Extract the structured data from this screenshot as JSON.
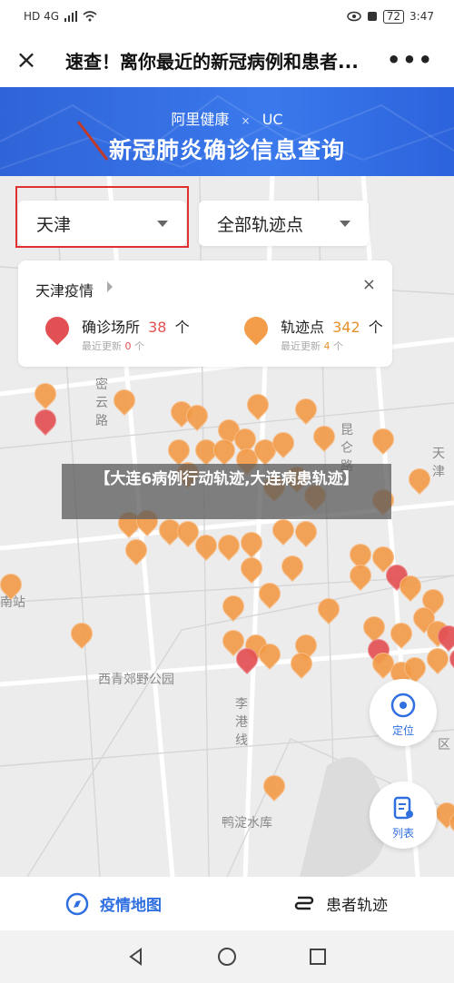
{
  "status_bar": {
    "left_text": "HD 4G",
    "battery": "72",
    "time": "3:47"
  },
  "app_bar": {
    "title": "速查！离你最近的新冠病例和患者..."
  },
  "banner": {
    "brand_left": "阿里健康",
    "separator": "×",
    "brand_right": "UC",
    "heading": "新冠肺炎确诊信息查询"
  },
  "filters": {
    "region": "天津",
    "points": "全部轨迹点"
  },
  "stats_card": {
    "header": "天津疫情",
    "confirmed_label": "确诊场所",
    "confirmed_count": "38",
    "confirmed_unit": "个",
    "confirmed_sub_prefix": "最近更新",
    "confirmed_sub_count": "0",
    "confirmed_sub_unit": "个",
    "track_label": "轨迹点",
    "track_count": "342",
    "track_unit": "个",
    "track_sub_prefix": "最近更新",
    "track_sub_count": "4",
    "track_sub_unit": "个"
  },
  "overlay_title": "【大连6病例行动轨迹,大连病患轨迹】",
  "map_labels": {
    "miyun": "密云路",
    "kunlun": "昆仑路",
    "tianjin_right": "天津",
    "nanzhan": "南站",
    "xiqing_park": "西青郊野公园",
    "ligang": "李港线",
    "yaduo": "鸭淀水库",
    "xiqu": "区"
  },
  "fabs": {
    "locate": "定位",
    "list": "列表"
  },
  "bottom_nav": {
    "map": "疫情地图",
    "tracks": "患者轨迹"
  },
  "colors": {
    "accent": "#2f6fe0",
    "pin_orange": "#f39c4a",
    "pin_red": "#e35054",
    "count_orange": "#e8902c",
    "count_red": "#e35054"
  },
  "icons": [
    "close-icon",
    "more-icon",
    "caret-down-icon",
    "map-pin-icon",
    "locate-icon",
    "list-icon",
    "compass-icon",
    "track-icon",
    "back-icon",
    "home-icon",
    "recents-icon"
  ]
}
